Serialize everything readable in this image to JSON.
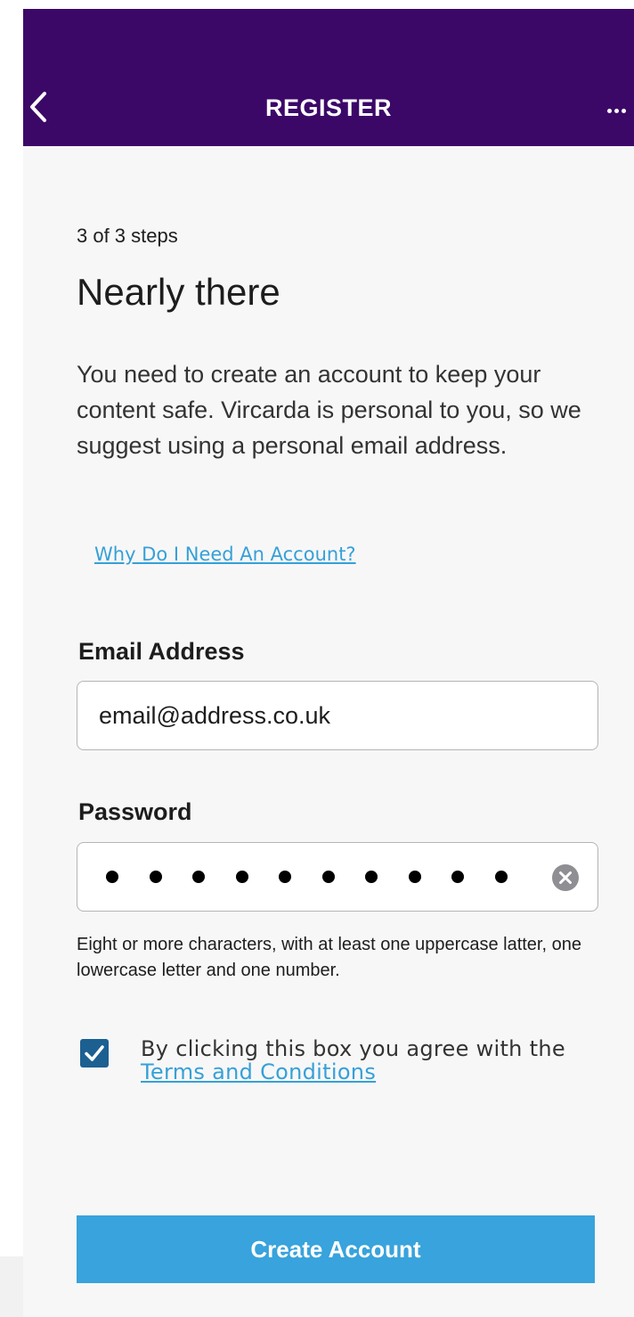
{
  "colors": {
    "header_bg": "#3c0868",
    "accent": "#38a3dc",
    "link": "#36a0d8",
    "checkbox": "#1c5f91",
    "page_bg": "#f7f7f7"
  },
  "header": {
    "title": "REGISTER",
    "back_icon": "chevron-left-icon",
    "more_icon": "more-horizontal-icon"
  },
  "main": {
    "step": "3 of 3 steps",
    "title": "Nearly there",
    "intro": "You need to create an account to keep your content safe. Vircarda is personal to you, so we suggest using a personal email address.",
    "why_link": "Why Do I Need An Account?"
  },
  "form": {
    "email_label": "Email Address",
    "email_value": "email@address.co.uk",
    "password_label": "Password",
    "password_masked_count": 10,
    "clear_icon": "clear-circle-icon",
    "password_hint": "Eight or more characters, with at least one uppercase latter, one lowercase letter and one number.",
    "terms_checked": true,
    "terms_text": "By clicking this box you agree with the",
    "terms_link": "Terms and Conditions",
    "submit_label": "Create Account"
  }
}
